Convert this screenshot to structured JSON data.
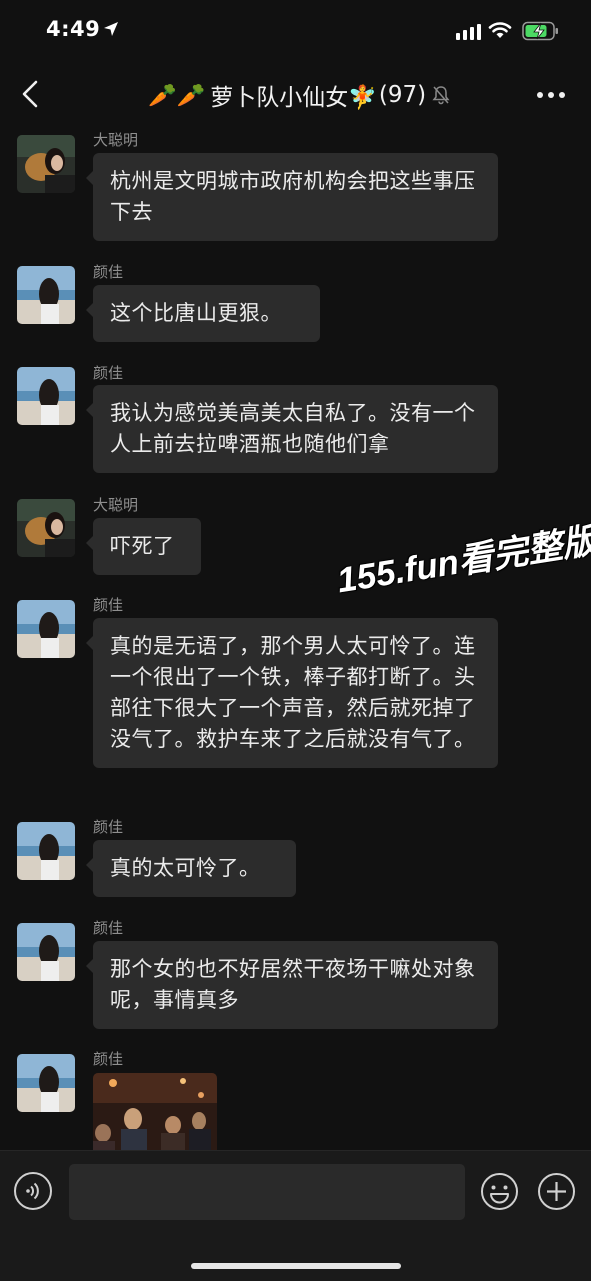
{
  "status_bar": {
    "time": "4:49",
    "icons": [
      "location-arrow-icon",
      "cellular-signal-icon",
      "wifi-icon",
      "battery-charging-icon"
    ],
    "battery_color": "#4cd964"
  },
  "header": {
    "title_emoji": "🥕🥕",
    "group_name": "萝卜队小仙女🧚",
    "member_count": "(97)",
    "icons": [
      "back-chevron-icon",
      "mute-bell-icon",
      "more-dots-icon"
    ]
  },
  "messages": [
    {
      "sender": "大聪明",
      "text": "杭州是文明城市政府机构会把这些事压下去",
      "avatar": "avatar-dog-girl"
    },
    {
      "sender": "颜佳",
      "text": "这个比唐山更狠。",
      "avatar": "avatar-beach-girl"
    },
    {
      "sender": "颜佳",
      "text": "我认为感觉美高美太自私了。没有一个人上前去拉啤酒瓶也随他们拿",
      "avatar": "avatar-beach-girl"
    },
    {
      "sender": "大聪明",
      "text": "吓死了",
      "avatar": "avatar-dog-girl"
    },
    {
      "sender": "颜佳",
      "text": "真的是无语了，那个男人太可怜了。连一个很出了一个铁，棒子都打断了。头部往下很大了一个声音，然后就死掉了没气了。救护车来了之后就没有气了。",
      "avatar": "avatar-beach-girl"
    },
    {
      "sender": "颜佳",
      "text": "真的太可怜了。",
      "avatar": "avatar-beach-girl"
    },
    {
      "sender": "颜佳",
      "text": "那个女的也不好居然干夜场干嘛处对象呢，事情真多",
      "avatar": "avatar-beach-girl"
    },
    {
      "sender": "颜佳",
      "type": "image",
      "avatar": "avatar-beach-girl"
    }
  ],
  "watermark": "155.fun看完整版",
  "input_bar": {
    "placeholder": "",
    "icons": [
      "voice-icon",
      "emoji-icon",
      "add-icon"
    ]
  },
  "colors": {
    "background": "#111111",
    "bubble": "#2c2c2c",
    "sender_name": "#8f8f8f",
    "input_bar": "#1a1a1a"
  }
}
